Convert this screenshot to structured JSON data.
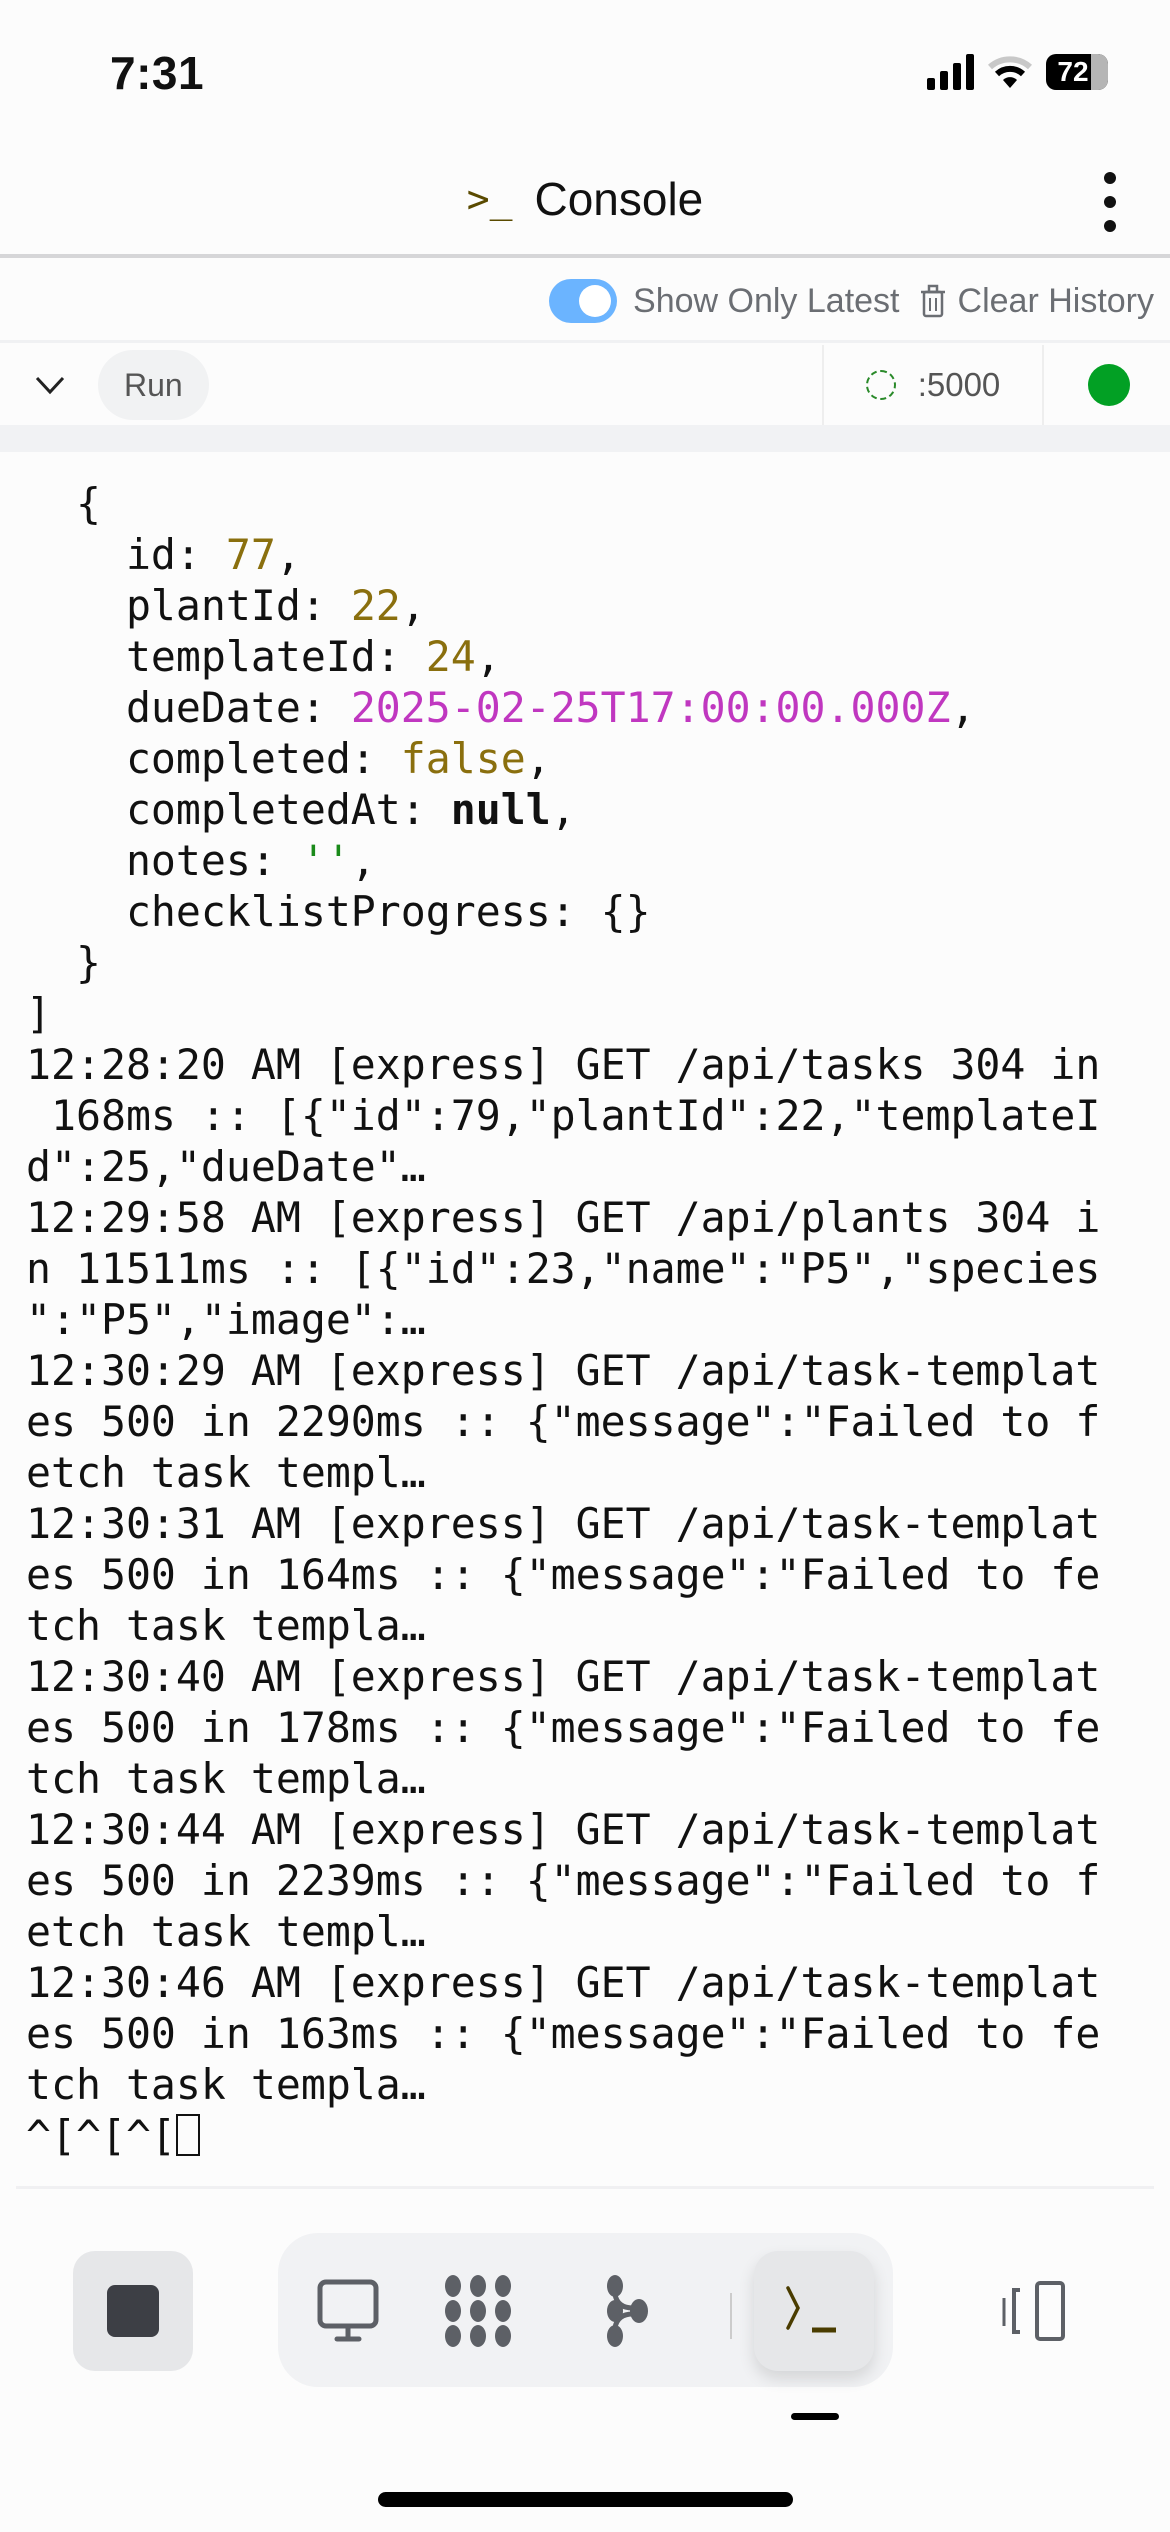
{
  "status_bar": {
    "time": "7:31",
    "battery": "72"
  },
  "header": {
    "title": "Console",
    "title_icon": "terminal-prompt-icon",
    "menu_icon": "kebab-menu-icon"
  },
  "toolbar": {
    "show_only_latest_label": "Show Only Latest",
    "show_only_latest_on": true,
    "clear_history_label": "Clear History",
    "run_label": "Run",
    "port_label": ":5000",
    "status_color": "#02a024",
    "toggle_color": "#6bb4ff"
  },
  "console": {
    "lines": [
      [
        {
          "t": "  {"
        }
      ],
      [
        {
          "t": "    id: "
        },
        {
          "t": "77",
          "c": "num"
        },
        {
          "t": ","
        }
      ],
      [
        {
          "t": "    plantId: "
        },
        {
          "t": "22",
          "c": "num"
        },
        {
          "t": ","
        }
      ],
      [
        {
          "t": "    templateId: "
        },
        {
          "t": "24",
          "c": "num"
        },
        {
          "t": ","
        }
      ],
      [
        {
          "t": "    dueDate: "
        },
        {
          "t": "2025-02-25T17:00:00.000Z",
          "c": "date"
        },
        {
          "t": ","
        }
      ],
      [
        {
          "t": "    completed: "
        },
        {
          "t": "false",
          "c": "num"
        },
        {
          "t": ","
        }
      ],
      [
        {
          "t": "    completedAt: "
        },
        {
          "t": "null",
          "c": "bold"
        },
        {
          "t": ","
        }
      ],
      [
        {
          "t": "    notes: "
        },
        {
          "t": "''",
          "c": "str"
        },
        {
          "t": ","
        }
      ],
      [
        {
          "t": "    checklistProgress: {}"
        }
      ],
      [
        {
          "t": "  }"
        }
      ],
      [
        {
          "t": "]"
        }
      ],
      [
        {
          "t": "12:28:20 AM [express] GET /api/tasks 304 in"
        }
      ],
      [
        {
          "t": " 168ms :: [{\"id\":79,\"plantId\":22,\"templateI"
        }
      ],
      [
        {
          "t": "d\":25,\"dueDate\"…"
        }
      ],
      [
        {
          "t": "12:29:58 AM [express] GET /api/plants 304 i"
        }
      ],
      [
        {
          "t": "n 11511ms :: [{\"id\":23,\"name\":\"P5\",\"species"
        }
      ],
      [
        {
          "t": "\":\"P5\",\"image\":…"
        }
      ],
      [
        {
          "t": "12:30:29 AM [express] GET /api/task-templat"
        }
      ],
      [
        {
          "t": "es 500 in 2290ms :: {\"message\":\"Failed to f"
        }
      ],
      [
        {
          "t": "etch task templ…"
        }
      ],
      [
        {
          "t": "12:30:31 AM [express] GET /api/task-templat"
        }
      ],
      [
        {
          "t": "es 500 in 164ms :: {\"message\":\"Failed to fe"
        }
      ],
      [
        {
          "t": "tch task templa…"
        }
      ],
      [
        {
          "t": "12:30:40 AM [express] GET /api/task-templat"
        }
      ],
      [
        {
          "t": "es 500 in 178ms :: {\"message\":\"Failed to fe"
        }
      ],
      [
        {
          "t": "tch task templa…"
        }
      ],
      [
        {
          "t": "12:30:44 AM [express] GET /api/task-templat"
        }
      ],
      [
        {
          "t": "es 500 in 2239ms :: {\"message\":\"Failed to f"
        }
      ],
      [
        {
          "t": "etch task templ…"
        }
      ],
      [
        {
          "t": "12:30:46 AM [express] GET /api/task-templat"
        }
      ],
      [
        {
          "t": "es 500 in 163ms :: {\"message\":\"Failed to fe"
        }
      ],
      [
        {
          "t": "tch task templa…"
        }
      ],
      [
        {
          "t": "^[^[^["
        },
        {
          "cursor": true
        }
      ]
    ]
  },
  "bottom_nav": {
    "items": [
      "stop-icon",
      "desktop-icon",
      "workspace-dots-icon",
      "git-branch-icon",
      "terminal-icon",
      "devices-icon"
    ],
    "active": "terminal-icon"
  }
}
